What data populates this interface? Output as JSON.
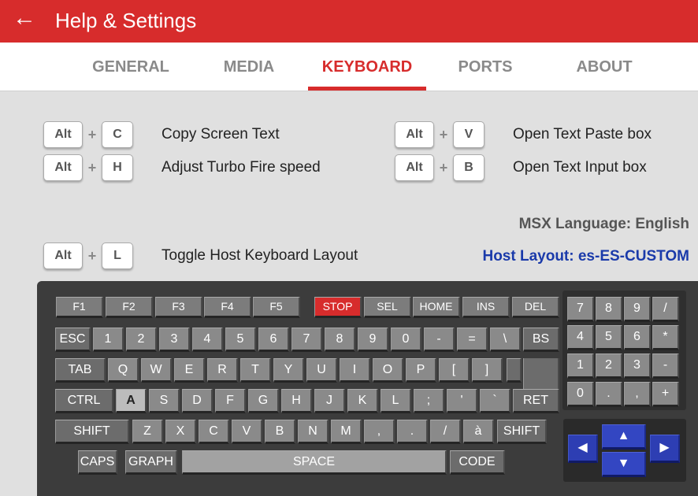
{
  "header": {
    "title": "Help & Settings",
    "back_icon": "←"
  },
  "tabs": [
    {
      "label": "GENERAL",
      "active": false
    },
    {
      "label": "MEDIA",
      "active": false
    },
    {
      "label": "KEYBOARD",
      "active": true
    },
    {
      "label": "PORTS",
      "active": false
    },
    {
      "label": "ABOUT",
      "active": false
    }
  ],
  "colors": {
    "accent": "#d72c2c",
    "host_layout": "#1a3aaa",
    "arrow_keys": "#2d3eb3",
    "stop_key": "#d72c2c"
  },
  "shortcuts": [
    {
      "modifier": "Alt",
      "plus": "+",
      "key": "C",
      "description": "Copy Screen Text"
    },
    {
      "modifier": "Alt",
      "plus": "+",
      "key": "V",
      "description": "Open Text Paste box"
    },
    {
      "modifier": "Alt",
      "plus": "+",
      "key": "H",
      "description": "Adjust Turbo Fire speed"
    },
    {
      "modifier": "Alt",
      "plus": "+",
      "key": "B",
      "description": "Open Text Input box"
    },
    {
      "modifier": "Alt",
      "plus": "+",
      "key": "L",
      "description": "Toggle Host Keyboard Layout"
    }
  ],
  "msx_language": "MSX Language: English",
  "host_layout": "Host Layout:  es-ES-CUSTOM",
  "keyboard": {
    "function_row": [
      "F1",
      "F2",
      "F3",
      "F4",
      "F5",
      "STOP",
      "SEL",
      "HOME",
      "INS",
      "DEL"
    ],
    "row1": [
      "ESC",
      "1",
      "2",
      "3",
      "4",
      "5",
      "6",
      "7",
      "8",
      "9",
      "0",
      "-",
      "=",
      "\\",
      "BS"
    ],
    "row2": [
      "TAB",
      "Q",
      "W",
      "E",
      "R",
      "T",
      "Y",
      "U",
      "I",
      "O",
      "P",
      "[",
      "]"
    ],
    "row3": [
      "CTRL",
      "A",
      "S",
      "D",
      "F",
      "G",
      "H",
      "J",
      "K",
      "L",
      ";",
      "'",
      "`",
      "RET"
    ],
    "row4": [
      "SHIFT",
      "Z",
      "X",
      "C",
      "V",
      "B",
      "N",
      "M",
      ",",
      ".",
      "/",
      "à",
      "SHIFT"
    ],
    "row5": [
      "CAPS",
      "GRAPH",
      "SPACE",
      "CODE"
    ],
    "numpad": [
      "7",
      "8",
      "9",
      "/",
      "4",
      "5",
      "6",
      "*",
      "1",
      "2",
      "3",
      "-",
      "0",
      ".",
      ",",
      "+"
    ],
    "arrows": {
      "up": "▲",
      "left": "◀",
      "down": "▼",
      "right": "▶"
    }
  }
}
